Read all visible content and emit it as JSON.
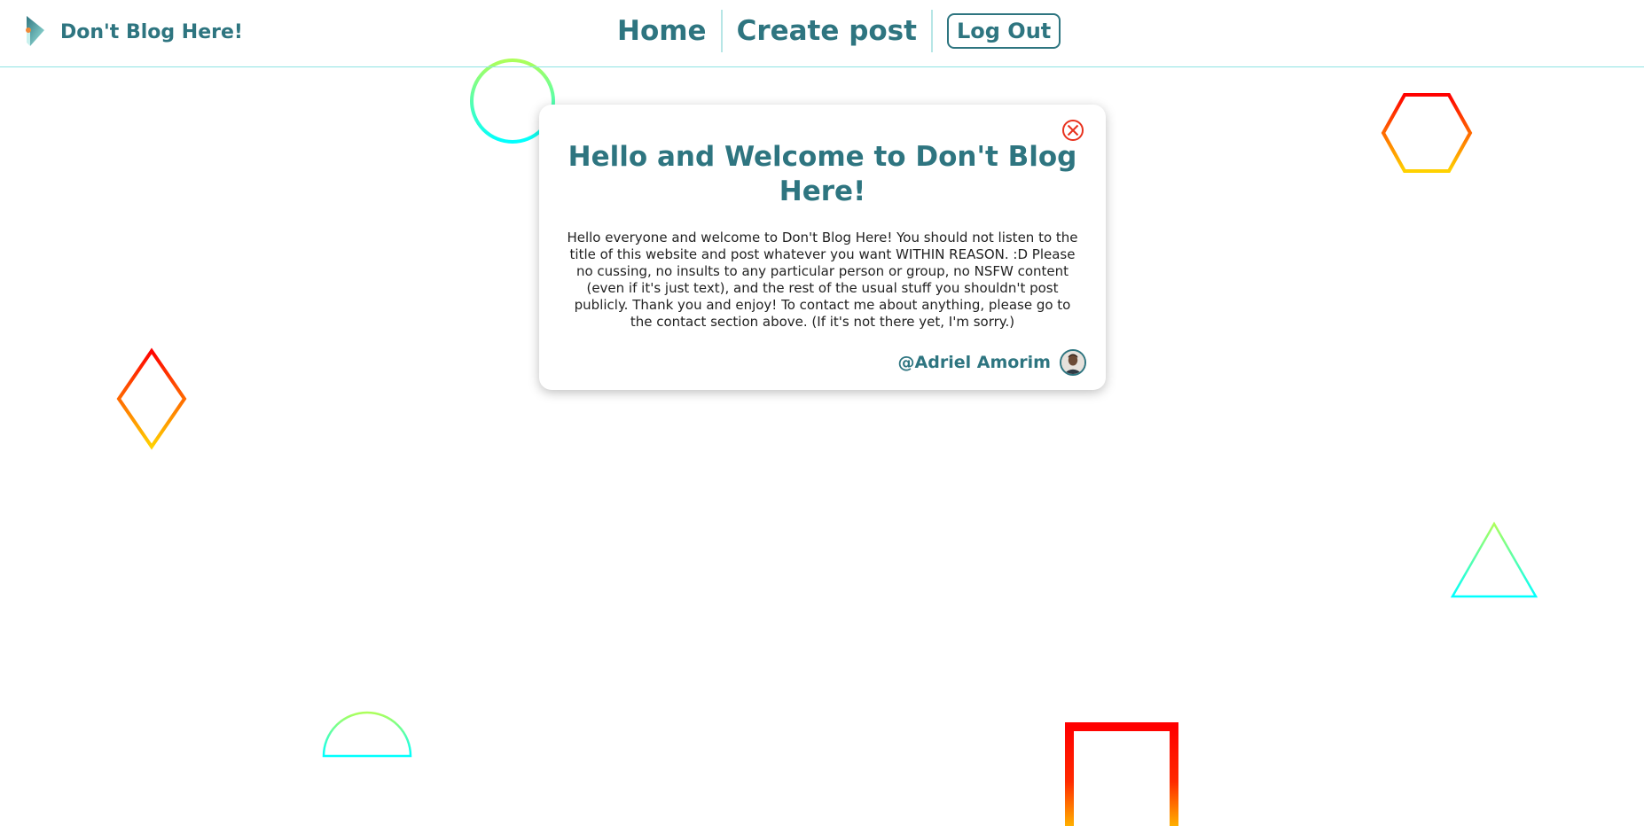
{
  "header": {
    "brand_name": "Don't Blog Here!",
    "brand_icon": "blog-logo-icon",
    "nav": {
      "home_label": "Home",
      "create_post_label": "Create post",
      "logout_label": "Log Out"
    }
  },
  "welcome_modal": {
    "title": "Hello and Welcome to Don't Blog Here!",
    "body": "Hello everyone and welcome to Don't Blog Here! You should not listen to the title of this website and post whatever you want WITHIN REASON. :D Please no cussing, no insults to any particular person or group, no NSFW content (even if it's just text), and the rest of the usual stuff you shouldn't post publicly. Thank you and enjoy! To contact me about anything, please go to the contact section above. (If it's not there yet, I'm sorry.)",
    "author": "@Adriel Amorim",
    "close_icon": "close-circle-icon",
    "avatar_icon": "author-avatar"
  },
  "colors": {
    "primary": "#2e7580",
    "nav_border": "#8fe3e3",
    "close_red": "#e8321e",
    "gradient_red": "#ff0000",
    "gradient_orange": "#ffa500",
    "gradient_yellow": "#ffd200",
    "gradient_green": "#adff5a",
    "gradient_cyan": "#00ffff"
  },
  "decorations": [
    "circle-outline",
    "hexagon-outline",
    "diamond-outline",
    "triangle-outline",
    "semicircle-outline",
    "doorway-outline"
  ]
}
